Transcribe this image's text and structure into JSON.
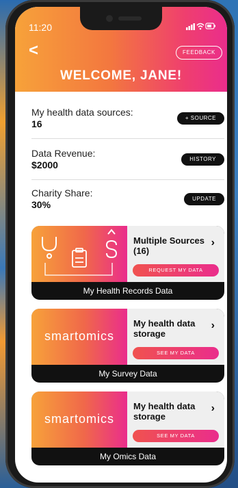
{
  "status_bar": {
    "time": "11:20",
    "signal_wifi_battery": "▮▮▮ ◠ ▭"
  },
  "header": {
    "back_glyph": "<",
    "feedback_label": "FEEDBACK",
    "welcome_text": "WELCOME, JANE!"
  },
  "stats": [
    {
      "label": "My health data sources:",
      "value": "16",
      "button": "+ SOURCE"
    },
    {
      "label": "Data Revenue:",
      "value": "$2000",
      "button": "HISTORY"
    },
    {
      "label": "Charity Share:",
      "value": "30%",
      "button": "UPDATE"
    }
  ],
  "cards": [
    {
      "title": "Multiple Sources (16)",
      "button": "REQUEST MY DATA",
      "footer": "My Health Records Data",
      "arrow": "›",
      "image_icons": [
        "stethoscope-icon",
        "clipboard-icon",
        "dollar-icon"
      ]
    },
    {
      "title": "My health data storage",
      "button": "SEE MY DATA",
      "footer": "My Survey Data",
      "brand": "smartomics",
      "arrow": "›"
    },
    {
      "title": "My health data storage",
      "button": "SEE MY DATA",
      "footer": "My Omics Data",
      "brand": "smartomics",
      "arrow": "›"
    }
  ],
  "colors": {
    "accent_orange": "#f7a23a",
    "accent_pink": "#ea2d8c",
    "pill_bg": "#111111"
  }
}
